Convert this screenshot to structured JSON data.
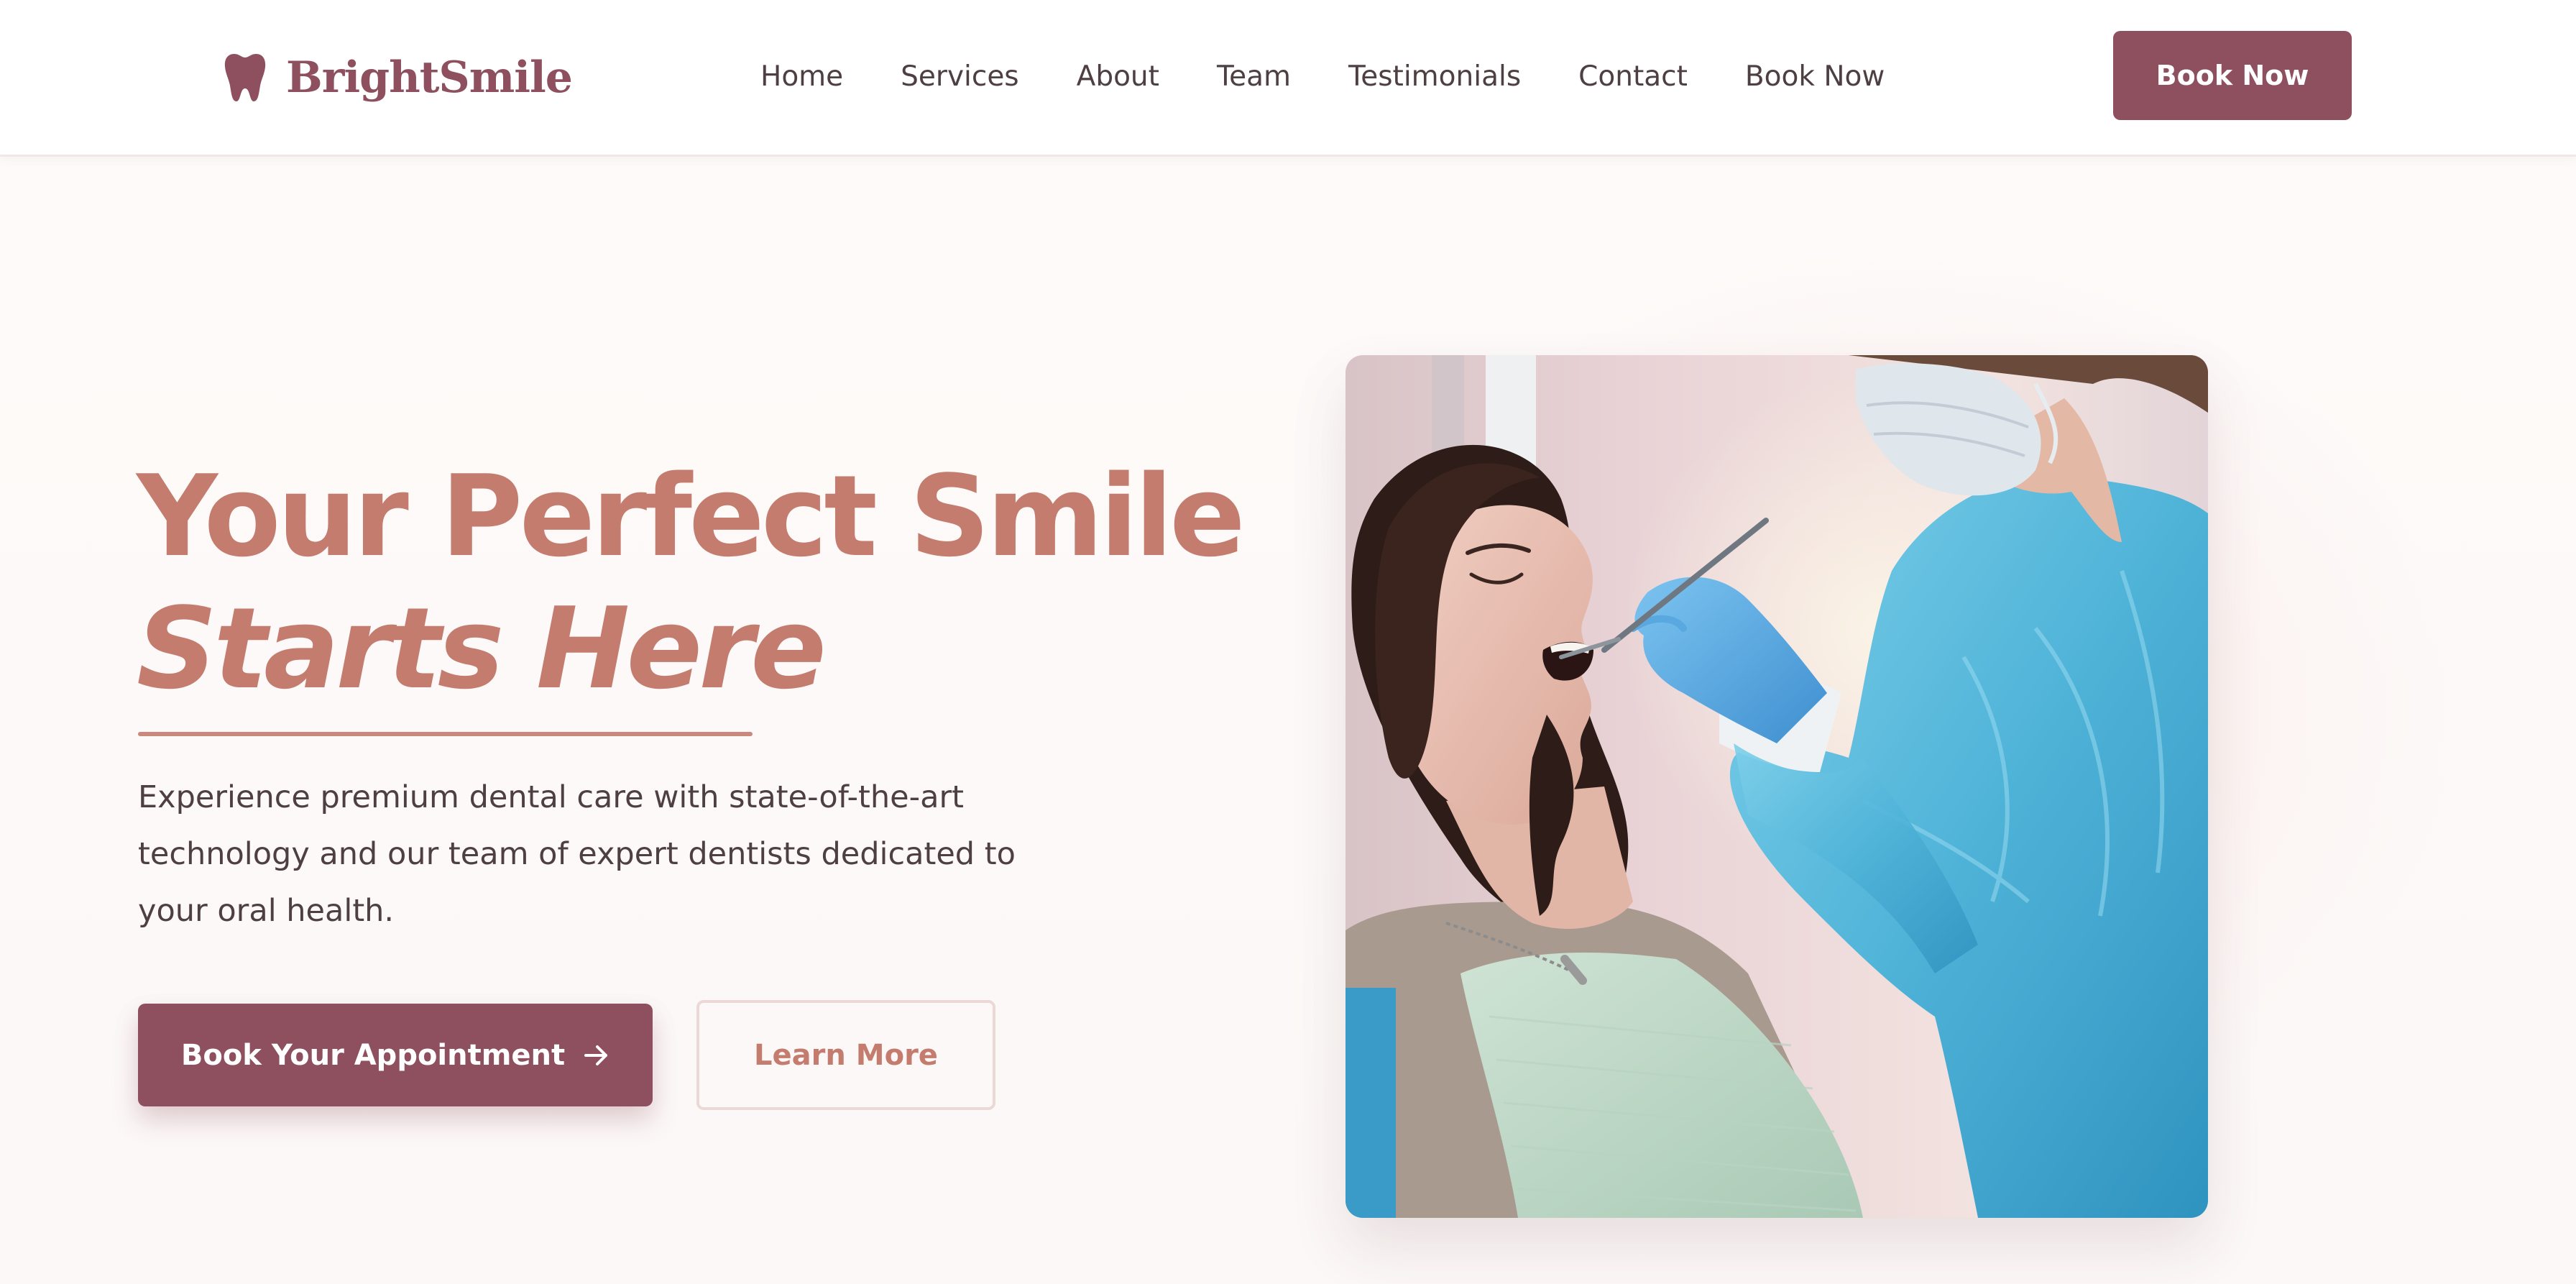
{
  "brand": {
    "name": "BrightSmile",
    "icon": "tooth-icon",
    "color": "#8e4f5f"
  },
  "nav": {
    "links": [
      "Home",
      "Services",
      "About",
      "Team",
      "Testimonials",
      "Contact",
      "Book Now"
    ],
    "cta_label": "Book Now"
  },
  "hero": {
    "title_line1": "Your Perfect Smile",
    "title_line2": "Starts Here",
    "description": "Experience premium dental care with state-of-the-art technology and our team of expert dentists dedicated to your oral health.",
    "primary_button": "Book Your Appointment",
    "primary_button_icon": "arrow-right-icon",
    "secondary_button": "Learn More",
    "accent_color": "#c47c6f"
  }
}
